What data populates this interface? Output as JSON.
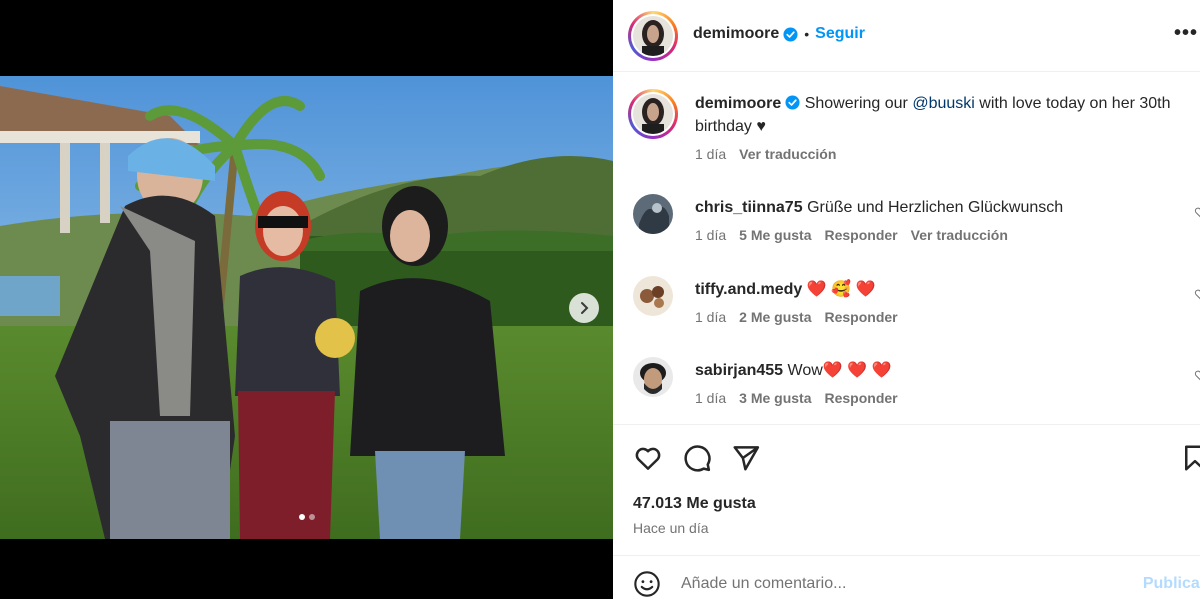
{
  "post": {
    "author": "demimoore",
    "follow_label": "Seguir",
    "bullet": "•",
    "more_label": "•••",
    "caption_user": "demimoore",
    "caption_before": "Showering our ",
    "caption_mention": "@buuski",
    "caption_after": " with love today on her 30th birthday ♥",
    "caption_time": "1 día",
    "caption_translate": "Ver traducción"
  },
  "comments": [
    {
      "user": "chris_tiinna75",
      "text": "Grüße und Herzlichen Glückwunsch",
      "time": "1 día",
      "likes": "5 Me gusta",
      "reply": "Responder",
      "translate": "Ver traducción"
    },
    {
      "user": "tiffy.and.medy",
      "text": "❤️ 🥰 ❤️",
      "time": "1 día",
      "likes": "2 Me gusta",
      "reply": "Responder"
    },
    {
      "user": "sabirjan455",
      "text": "Wow❤️ ❤️ ❤️",
      "time": "1 día",
      "likes": "3 Me gusta",
      "reply": "Responder"
    }
  ],
  "stats": {
    "likes": "47.013 Me gusta",
    "time_ago": "Hace un día"
  },
  "composer": {
    "placeholder": "Añade un comentario...",
    "publish_label": "Publicar"
  },
  "carousel": {
    "slide_count": 2,
    "active_index": 0
  },
  "colors": {
    "accent": "#0095f6",
    "verified": "#0095f6",
    "muted": "#737373",
    "heart": "#ed1c24"
  },
  "icons": {
    "like": "heart-outline-icon",
    "comment": "speech-bubble-icon",
    "share": "paper-plane-icon",
    "save": "bookmark-icon",
    "emoji": "smiley-icon",
    "next": "chevron-right-icon"
  }
}
